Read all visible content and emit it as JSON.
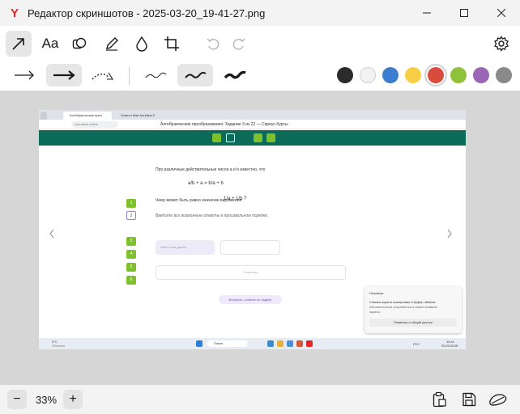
{
  "window": {
    "title": "Редактор скриншотов - 2025-03-20_19-41-27.png",
    "logo_letter": "Y"
  },
  "toolbar": {
    "tools": [
      "arrow-tool",
      "text-tool",
      "shape-tool",
      "pen-tool",
      "blur-tool",
      "crop-tool",
      "undo",
      "redo",
      "settings"
    ],
    "text_tool_label": "Aa",
    "active_tool": "arrow-tool",
    "arrow_styles": [
      "thin-arrow",
      "thick-arrow",
      "dashed-arrow"
    ],
    "active_arrow_style": "thick-arrow",
    "stroke_widths": [
      "thin",
      "medium",
      "thick"
    ],
    "active_stroke": "medium",
    "colors": [
      "#2b2b2b",
      "#f2f2f2",
      "#3b7ecf",
      "#f7cf46",
      "#d94b3c",
      "#8fc23a",
      "#9a67b6",
      "#8a8a8a"
    ],
    "selected_color": "#d94b3c"
  },
  "screenshot": {
    "tab_1": "Алгебраические прео",
    "tab_2": "Ответы Mail Алгебра 0",
    "url": "edu.sirius.online",
    "page_title": "Алгебраические преобразования. Задание 3 из 22 — Сириус.Курсы",
    "problem_intro": "Про различные действительные числа a и b известно, что",
    "formula_1": "a/b + a = b/a + b",
    "question": "Чему может быть равно значение выражения",
    "formula_2": "1/a + 1/b ?",
    "instruction": "Введите все возможные ответы в произвольном порядке.",
    "question_numbers": [
      "1",
      "2",
      "3",
      "4",
      "5",
      "6"
    ],
    "current_question": "2",
    "input_placeholder": "Число или дробь",
    "check_button": "Отметить",
    "help_link": "Вопросы—ответы по задаче",
    "notification_title": "Ножницы",
    "notification_text_1": "Снимок экрана скопирован в буфер обмена",
    "notification_text_2": "Автоматически сохраняется в папке снимков",
    "notification_text_3": "экрана.",
    "notification_button": "Разметка и общий доступ",
    "weather_temp": "5°C",
    "weather_desc": "Облачно",
    "taskbar_search": "Поиск",
    "taskbar_lang": "РУС",
    "clock_time": "19:41",
    "clock_date": "20.03.2025"
  },
  "bottom": {
    "zoom_label": "33%",
    "zoom_out": "−",
    "zoom_in": "+"
  }
}
